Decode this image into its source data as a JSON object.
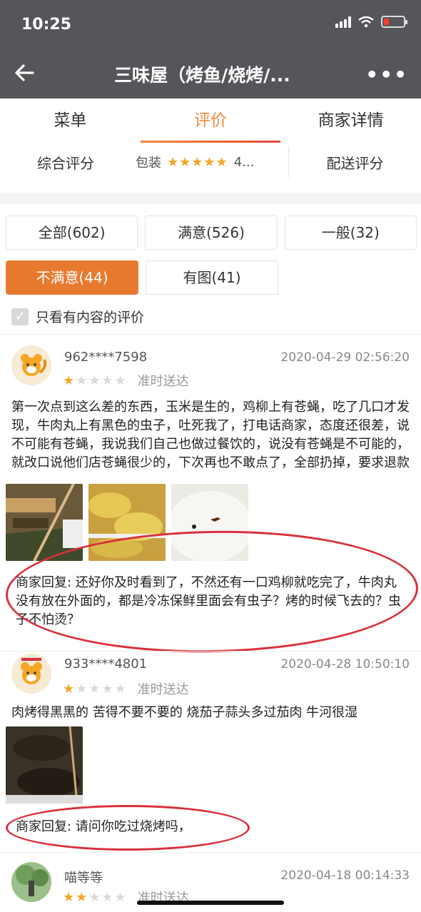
{
  "status": {
    "time": "10:25"
  },
  "header": {
    "title": "三味屋（烤鱼/烧烤/..."
  },
  "tabs": [
    "菜单",
    "评价",
    "商家详情"
  ],
  "scores": {
    "overall_label": "综合评分",
    "packaging_label": "包装",
    "packaging_value": "4...",
    "delivery_label": "配送评分"
  },
  "filters": {
    "all": "全部(602)",
    "satisfied": "满意(526)",
    "average": "一般(32)",
    "unsatisfied": "不满意(44)",
    "with_photos": "有图(41)",
    "only_content": "只看有内容的评价"
  },
  "reviews": [
    {
      "user": "962****7598",
      "date": "2020-04-29 02:56:20",
      "stars": 1,
      "tag": "准时送达",
      "content": "第一次点到这么差的东西，玉米是生的，鸡柳上有苍蝇，吃了几口才发现，牛肉丸上有黑色的虫子，吐死我了，打电话商家，态度还很差，说不可能有苍蝇，我说我们自己也做过餐饮的，说没有苍蝇是不可能的，就改口说他们店苍蝇很少的，下次再也不敢点了，全部扔掉，要求退款",
      "reply": "商家回复: 还好你及时看到了，不然还有一口鸡柳就吃完了，牛肉丸没有放在外面的，都是冷冻保鲜里面会有虫子？烤的时候飞去的？虫子不怕烫？"
    },
    {
      "user": "933****4801",
      "date": "2020-04-28 10:50:10",
      "stars": 1,
      "tag": "准时送达",
      "content": "肉烤得黑黑的 苦得不要不要的 烧茄子蒜头多过茄肉 牛河很湿",
      "reply": "商家回复: 请问你吃过烧烤吗，"
    },
    {
      "user": "喵等等",
      "date": "2020-04-18 00:14:33",
      "stars": 2,
      "tag": "准时送达"
    }
  ],
  "colors": {
    "accent": "#f08a3a",
    "chip_selected": "#e87a30",
    "header_bg": "#545659",
    "annotation": "#d9303a",
    "star": "#f5a623"
  }
}
